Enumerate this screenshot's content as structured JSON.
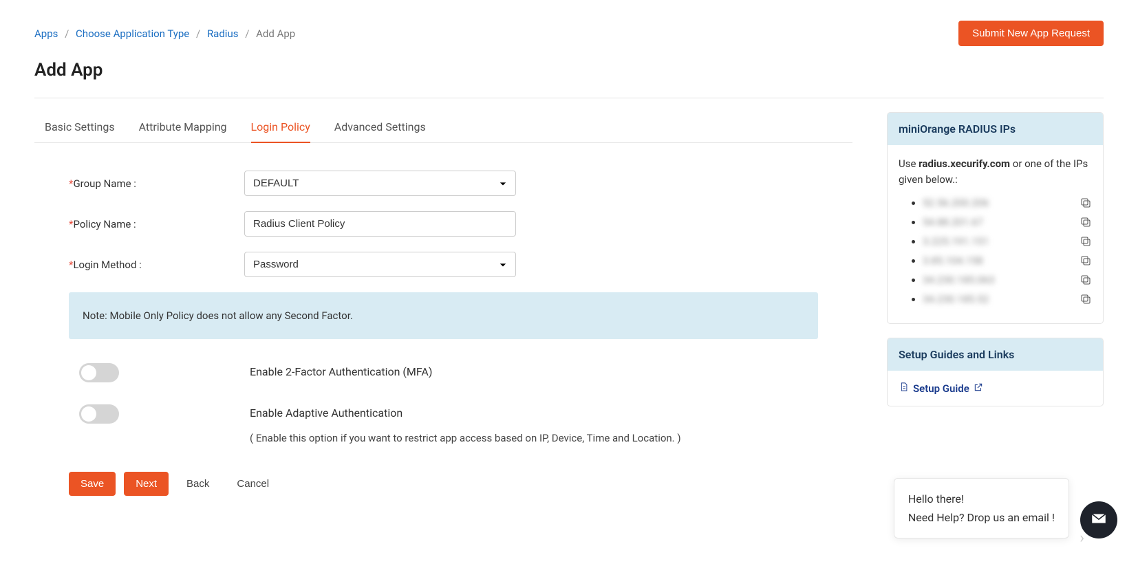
{
  "breadcrumb": {
    "items": [
      "Apps",
      "Choose Application Type",
      "Radius"
    ],
    "current": "Add App"
  },
  "header": {
    "submit_label": "Submit New App Request",
    "title": "Add App"
  },
  "tabs": [
    {
      "label": "Basic Settings",
      "active": false
    },
    {
      "label": "Attribute Mapping",
      "active": false
    },
    {
      "label": "Login Policy",
      "active": true
    },
    {
      "label": "Advanced Settings",
      "active": false
    }
  ],
  "form": {
    "group_name": {
      "label": "Group Name :",
      "value": "DEFAULT"
    },
    "policy_name": {
      "label": "Policy Name :",
      "value": "Radius Client Policy"
    },
    "login_method": {
      "label": "Login Method :",
      "value": "Password"
    },
    "note": "Note: Mobile Only Policy does not allow any Second Factor.",
    "mfa": {
      "label": "Enable 2-Factor Authentication (MFA)",
      "on": false
    },
    "adaptive": {
      "label": "Enable Adaptive Authentication",
      "sub": "( Enable this option if you want to restrict app access based on IP, Device, Time and Location. )",
      "on": false
    }
  },
  "buttons": {
    "save": "Save",
    "next": "Next",
    "back": "Back",
    "cancel": "Cancel"
  },
  "sidebar": {
    "radius_ips": {
      "header": "miniOrange RADIUS IPs",
      "intro_pre": "Use ",
      "intro_bold": "radius.xecurify.com",
      "intro_post": " or one of the IPs given below.:",
      "ips": [
        "52.56.200.206",
        "54.88.201.67",
        "3.225.191.151",
        "3.85.104.158",
        "34.230.185.063",
        "34.230.185.52"
      ]
    },
    "guides": {
      "header": "Setup Guides and Links",
      "link": "Setup Guide"
    }
  },
  "chat": {
    "line1": "Hello there!",
    "line2": "Need Help? Drop us an email !"
  }
}
